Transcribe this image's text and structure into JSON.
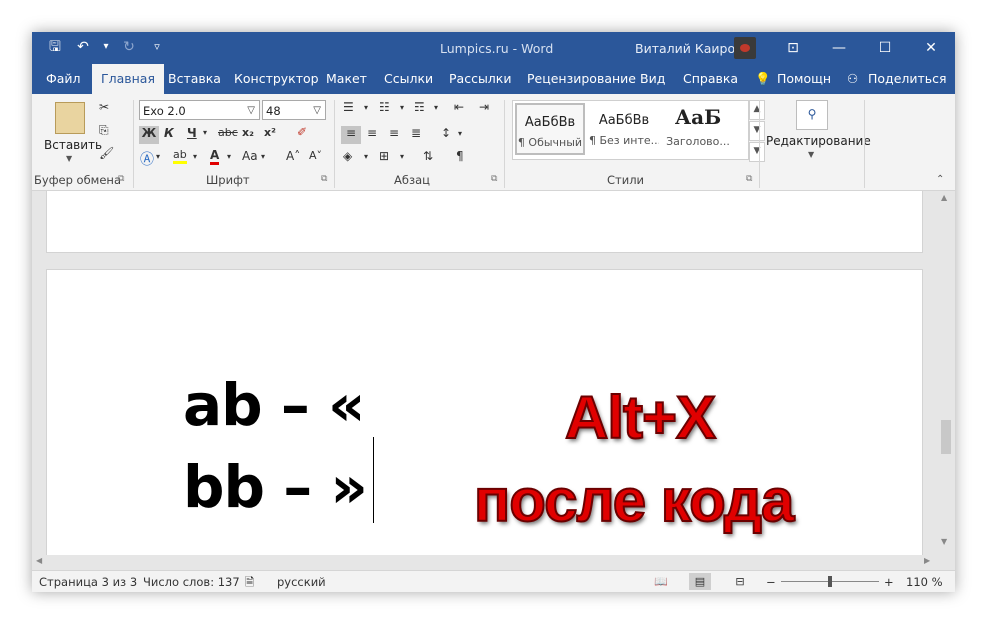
{
  "window": {
    "title": "Lumpics.ru  -  Word",
    "user": "Виталий Каиров",
    "controls": {
      "ribbon_display": "⊡",
      "minimize": "—",
      "maximize": "☐",
      "close": "✕"
    }
  },
  "qat": {
    "save": "🖫",
    "undo": "↶",
    "undo_arrow": "▾",
    "redo": "↻",
    "customize": "▿"
  },
  "tabs": [
    "Файл",
    "Главная",
    "Вставка",
    "Конструктор",
    "Макет",
    "Ссылки",
    "Рассылки",
    "Рецензирование",
    "Вид",
    "Справка"
  ],
  "active_tab": "Главная",
  "tell_me": "Помощн",
  "share": "Поделиться",
  "ribbon": {
    "clipboard": {
      "paste_label": "Вставить",
      "group_label": "Буфер обмена"
    },
    "font": {
      "font_name": "Exo 2.0",
      "font_size": "48",
      "bold": "Ж",
      "italic": "К",
      "underline": "Ч",
      "strike": "abc",
      "sub": "x₂",
      "sup": "x²",
      "case_label": "Aa",
      "grow": "A˄",
      "shrink": "A˅",
      "group_label": "Шрифт"
    },
    "paragraph": {
      "group_label": "Абзац",
      "pilcrow": "¶"
    },
    "styles": {
      "items": [
        {
          "sample": "АаБбВв",
          "name": "¶ Обычный"
        },
        {
          "sample": "АаБбВв",
          "name": "¶ Без инте..."
        },
        {
          "sample": "АаБ",
          "name": "Заголово..."
        }
      ],
      "group_label": "Стили"
    },
    "editing": {
      "label": "Редактирование"
    }
  },
  "document": {
    "line1": "ab – «",
    "line2": "bb – »",
    "overlay_line1": "Alt+X",
    "overlay_line2": "после кода"
  },
  "statusbar": {
    "page": "Страница 3 из 3",
    "words": "Число слов: 137",
    "language": "русский",
    "zoom": "110 %",
    "zoom_level": 110
  },
  "colors": {
    "accent": "#2b579a",
    "overlay_text": "#e00000",
    "highlight": "#ffff00",
    "font_color": "#e00000"
  }
}
